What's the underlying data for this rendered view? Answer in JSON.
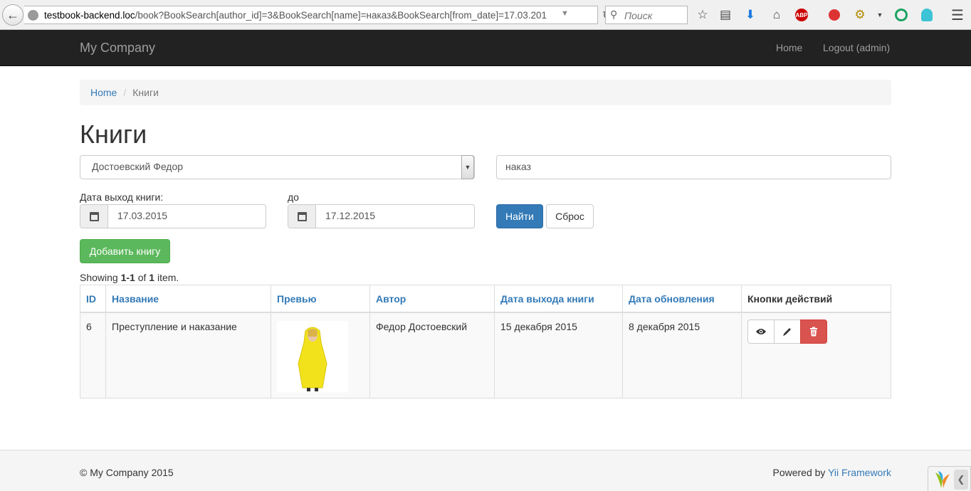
{
  "browser": {
    "url_host": "testbook-backend.loc",
    "url_path": "/book?BookSearch[author_id]=3&BookSearch[name]=наказ&BookSearch[from_date]=17.03.201",
    "search_placeholder": "Поиск",
    "abp_label": "ABP"
  },
  "navbar": {
    "brand": "My Company",
    "home": "Home",
    "logout": "Logout (admin)"
  },
  "breadcrumb": {
    "home": "Home",
    "separator": "/",
    "current": "Книги"
  },
  "page_title": "Книги",
  "filters": {
    "author_selected": "Достоевский Федор",
    "name_value": "наказ",
    "from_label": "Дата выход книги:",
    "from_value": "17.03.2015",
    "to_label": "до",
    "to_value": "17.12.2015",
    "find_button": "Найти",
    "reset_button": "Сброс"
  },
  "add_button": "Добавить книгу",
  "summary": {
    "prefix": "Showing ",
    "range": "1-1",
    "of": " of ",
    "total": "1",
    "suffix": " item."
  },
  "table": {
    "headers": [
      "ID",
      "Название",
      "Превью",
      "Автор",
      "Дата выхода книги",
      "Дата обновления",
      "Кнопки действий"
    ],
    "rows": [
      {
        "id": "6",
        "name": "Преступление и наказание",
        "author": "Федор Достоевский",
        "release_date": "15 декабря 2015",
        "updated": "8 декабря 2015"
      }
    ]
  },
  "footer": {
    "copyright": "© My Company 2015",
    "powered_prefix": "Powered by ",
    "powered_link": "Yii Framework"
  },
  "colors": {
    "primary": "#337ab7",
    "success": "#5cb85c",
    "danger": "#d9534f",
    "navbar": "#222222"
  }
}
